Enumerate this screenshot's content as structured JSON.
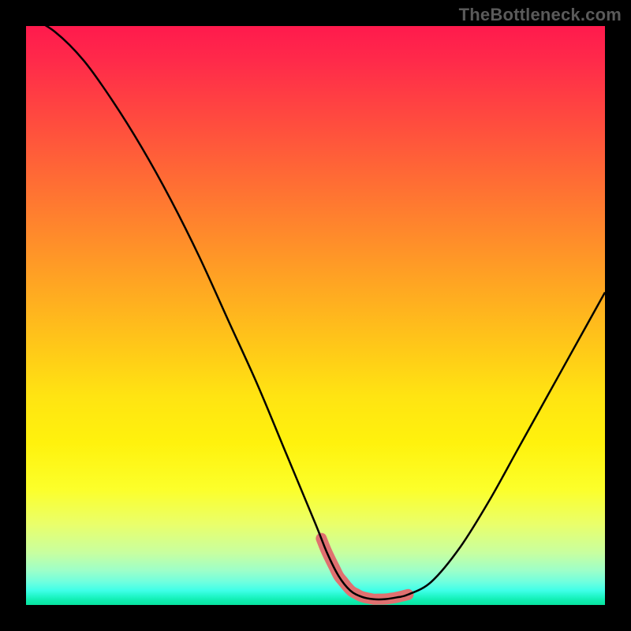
{
  "watermark": "TheBottleneck.com",
  "chart_data": {
    "type": "line",
    "title": "",
    "xlabel": "",
    "ylabel": "",
    "xlim": [
      0,
      100
    ],
    "ylim": [
      0,
      100
    ],
    "x": [
      0,
      5,
      10,
      15,
      20,
      25,
      30,
      35,
      40,
      45,
      50,
      52,
      54,
      56,
      58,
      60,
      62,
      64,
      66,
      70,
      75,
      80,
      85,
      90,
      95,
      100
    ],
    "values": [
      102,
      99,
      94,
      87,
      79,
      70,
      60,
      49,
      38,
      26,
      14,
      9,
      5,
      2.5,
      1.4,
      1,
      1,
      1.3,
      1.8,
      4,
      10,
      18,
      27,
      36,
      45,
      54
    ],
    "highlighted_range": {
      "x_start": 51,
      "x_end": 66,
      "y_approx": 1.5
    },
    "background_gradient_stops": [
      {
        "pos": 0.0,
        "color": "#ff1a4d"
      },
      {
        "pos": 0.5,
        "color": "#ffca18"
      },
      {
        "pos": 0.8,
        "color": "#fcff2a"
      },
      {
        "pos": 1.0,
        "color": "#08e4a0"
      }
    ],
    "annotations": [
      "TheBottleneck.com watermark top-right"
    ]
  }
}
